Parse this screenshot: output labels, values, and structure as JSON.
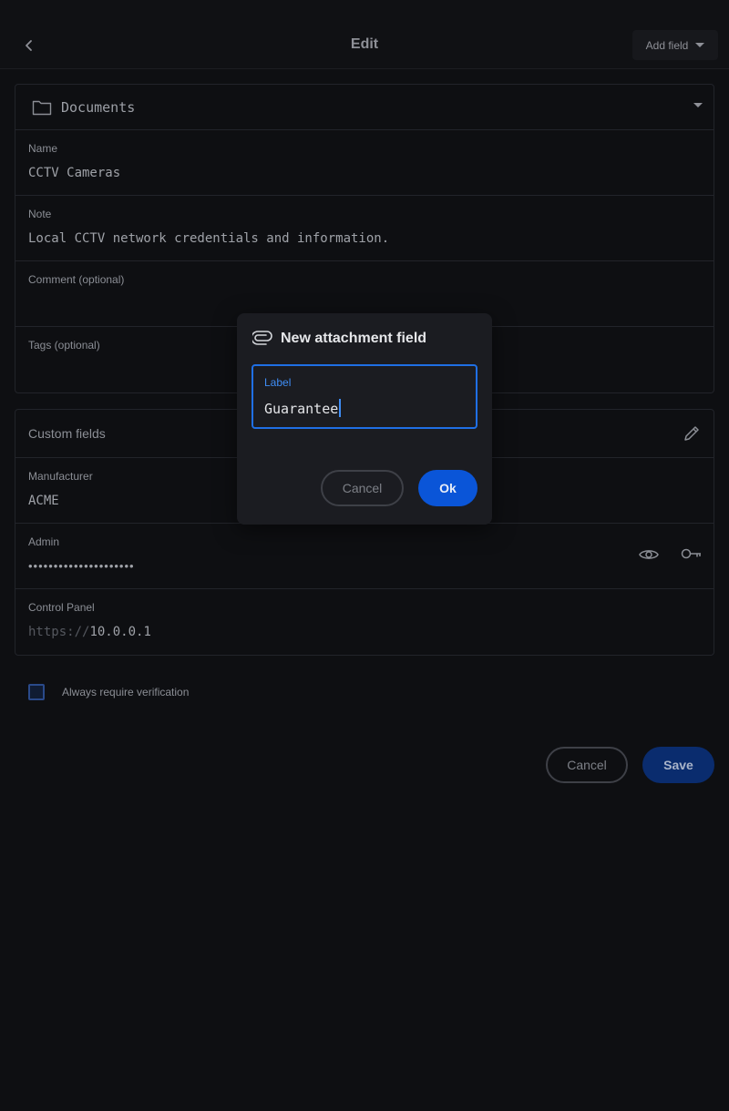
{
  "header": {
    "title": "Edit",
    "add_field_label": "Add field"
  },
  "item": {
    "folder": "Documents",
    "name_label": "Name",
    "name_value": "CCTV Cameras",
    "note_label": "Note",
    "note_value": "Local CCTV network credentials and information.",
    "comment_label": "Comment (optional)",
    "comment_value": "",
    "tags_label": "Tags (optional)",
    "tags_value": ""
  },
  "custom_fields": {
    "title": "Custom fields",
    "manufacturer_label": "Manufacturer",
    "manufacturer_value": "ACME",
    "admin_label": "Admin",
    "admin_value": "•••••••••••••••••••••",
    "control_panel_label": "Control Panel",
    "control_panel_protocol": "https://",
    "control_panel_host": "10.0.0.1"
  },
  "verification": {
    "label": "Always require verification",
    "checked": false
  },
  "footer": {
    "cancel_label": "Cancel",
    "save_label": "Save"
  },
  "dialog": {
    "title": "New attachment field",
    "input_label": "Label",
    "input_value": "Guarantee",
    "cancel_label": "Cancel",
    "ok_label": "Ok"
  },
  "colors": {
    "background": "#0e0f12",
    "accent": "#1f6fe5",
    "primary_button": "#0a55d8"
  }
}
